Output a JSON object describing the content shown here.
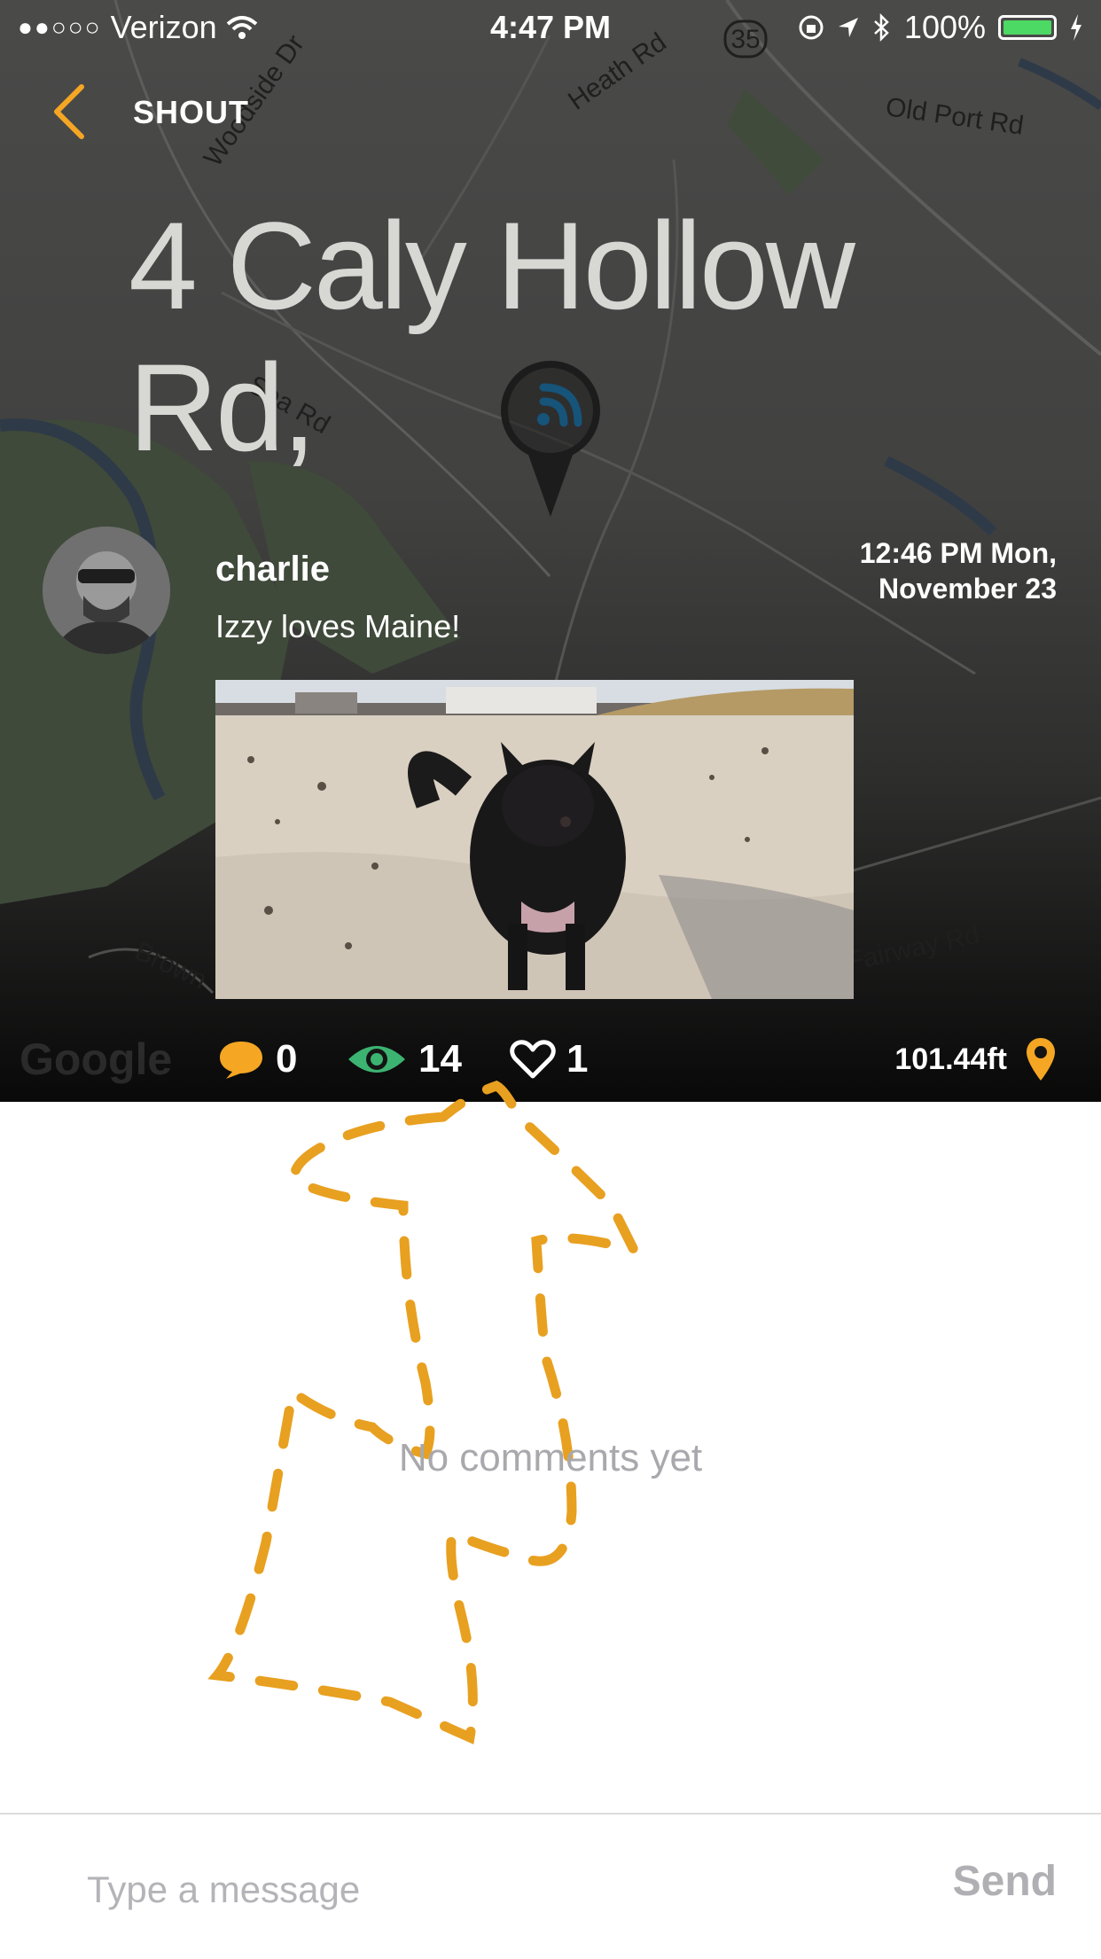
{
  "status_bar": {
    "carrier": "Verizon",
    "time": "4:47 PM",
    "battery": "100%",
    "battery_level": 1.0,
    "battery_color": "#4cd964"
  },
  "nav": {
    "title": "SHOUT",
    "back_icon": "chevron-left-icon"
  },
  "map": {
    "labels": [
      "Woodside Dr",
      "Heath Rd",
      "Old Port Rd",
      "Sea Rd",
      "Brown",
      "Fairway Rd"
    ],
    "route_badge": "35",
    "attribution": "Google"
  },
  "location_title": "4 Caly Hollow Rd,",
  "post": {
    "username": "charlie",
    "timestamp_time": "12:46 PM Mon,",
    "timestamp_date": "November 23",
    "text": "Izzy loves Maine!",
    "photo": "photo of black dog on sandy beach"
  },
  "stats": {
    "comments": "0",
    "views": "14",
    "likes": "1",
    "distance": "101.44ft"
  },
  "comments_empty": "No comments yet",
  "composer": {
    "placeholder": "Type a message",
    "send_label": "Send"
  },
  "colors": {
    "accent": "#f5a623",
    "views": "#3cb371",
    "header_bg": "#444443",
    "sketch": "#e8a020"
  }
}
